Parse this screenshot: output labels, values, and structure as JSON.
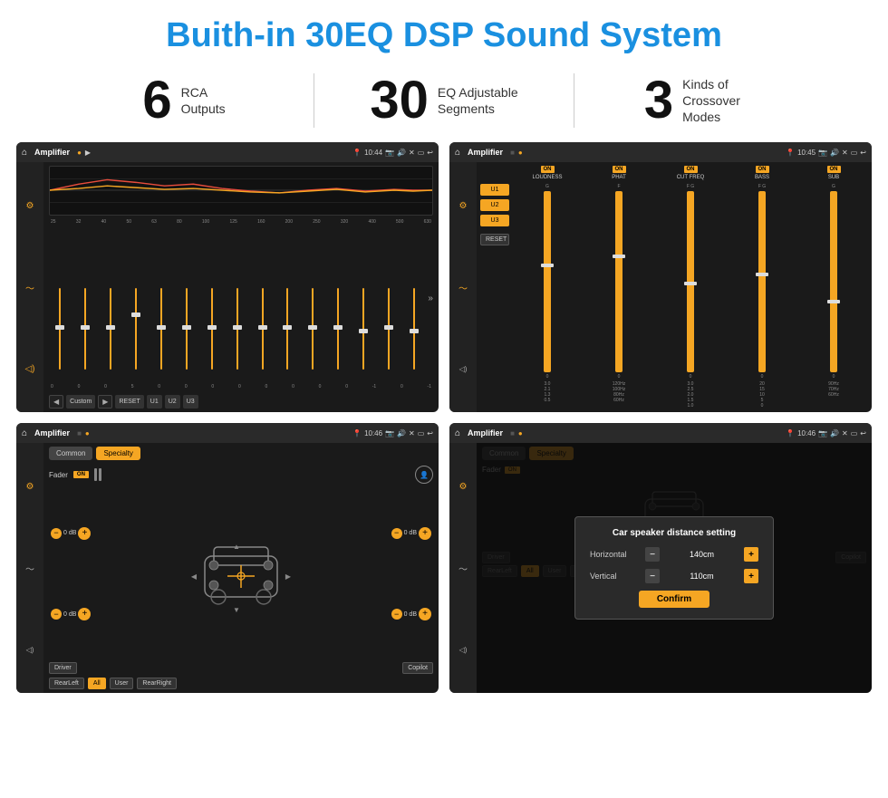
{
  "page": {
    "title": "Buith-in 30EQ DSP Sound System",
    "stats": [
      {
        "number": "6",
        "label": "RCA\nOutputs"
      },
      {
        "number": "30",
        "label": "EQ Adjustable\nSegments"
      },
      {
        "number": "3",
        "label": "Kinds of\nCrossover Modes"
      }
    ]
  },
  "screens": {
    "eq": {
      "topbar": {
        "time": "10:44",
        "title": "Amplifier"
      },
      "freq_labels": [
        "25",
        "32",
        "40",
        "50",
        "63",
        "80",
        "100",
        "125",
        "160",
        "200",
        "250",
        "320",
        "400",
        "500",
        "630"
      ],
      "value_labels": [
        "0",
        "0",
        "0",
        "5",
        "0",
        "0",
        "0",
        "0",
        "0",
        "0",
        "0",
        "0",
        "-1",
        "0",
        "-1"
      ],
      "preset_label": "Custom",
      "buttons": [
        "RESET",
        "U1",
        "U2",
        "U3"
      ]
    },
    "crossover": {
      "topbar": {
        "time": "10:45",
        "title": "Amplifier"
      },
      "presets": [
        "U1",
        "U2",
        "U3"
      ],
      "columns": [
        "LOUDNESS",
        "PHAT",
        "CUT FREQ",
        "BASS",
        "SUB"
      ],
      "on_labels": [
        "ON",
        "ON",
        "ON",
        "ON",
        "ON"
      ]
    },
    "fader": {
      "topbar": {
        "time": "10:46",
        "title": "Amplifier"
      },
      "tabs": [
        "Common",
        "Specialty"
      ],
      "fader_label": "Fader",
      "on_label": "ON",
      "bottom_buttons": [
        "Driver",
        "",
        "Copilot",
        "RearLeft",
        "All",
        "User",
        "RearRight"
      ]
    },
    "distance": {
      "topbar": {
        "time": "10:46",
        "title": "Amplifier"
      },
      "tabs": [
        "Common",
        "Specialty"
      ],
      "dialog": {
        "title": "Car speaker distance setting",
        "horizontal_label": "Horizontal",
        "horizontal_value": "140cm",
        "vertical_label": "Vertical",
        "vertical_value": "110cm",
        "confirm_label": "Confirm"
      }
    }
  }
}
